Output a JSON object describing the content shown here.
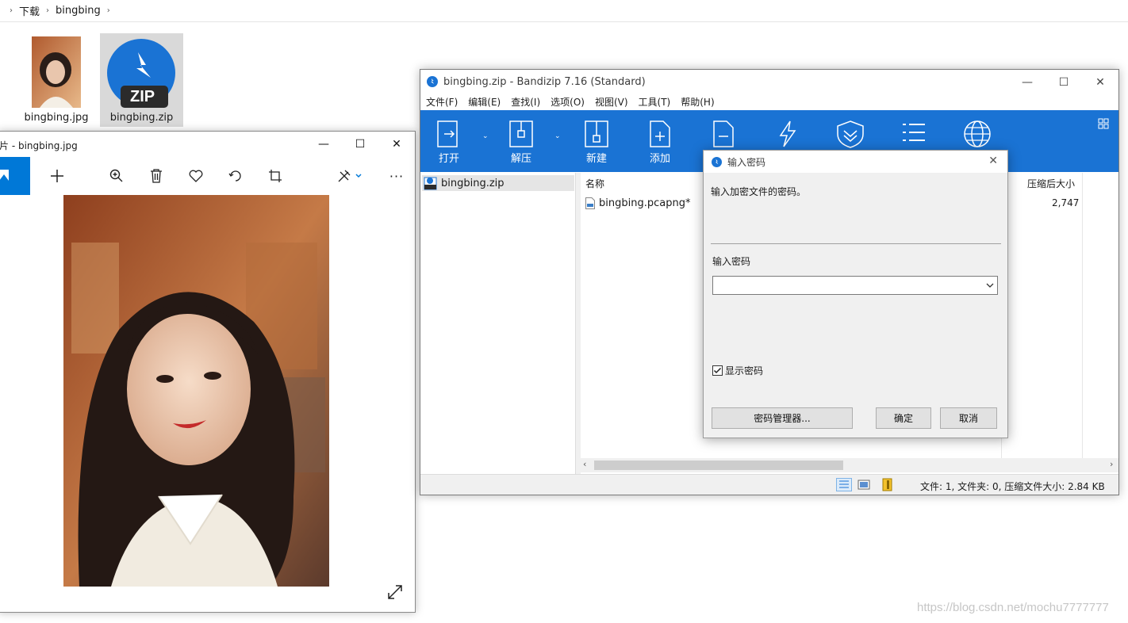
{
  "explorer": {
    "breadcrumb": [
      "下载",
      "bingbing"
    ],
    "files": [
      {
        "name": "bingbing.jpg",
        "icon": "photo-thumbnail"
      },
      {
        "name": "bingbing.zip",
        "icon": "bandizip-zip-icon",
        "badge": "ZIP"
      }
    ]
  },
  "photos": {
    "title": "片 - bingbing.jpg",
    "toolbar": [
      "photo-mode-icon",
      "add-icon",
      "zoom-icon",
      "delete-icon",
      "favorite-icon",
      "rotate-icon",
      "crop-icon",
      "edit-icon",
      "more-icon"
    ]
  },
  "bandizip": {
    "title": "bingbing.zip - Bandizip 7.16 (Standard)",
    "menu": [
      "文件(F)",
      "编辑(E)",
      "查找(I)",
      "选项(O)",
      "视图(V)",
      "工具(T)",
      "帮助(H)"
    ],
    "toolbar": [
      {
        "label": "打开",
        "icon": "open-icon"
      },
      {
        "label": "解压",
        "icon": "extract-icon"
      },
      {
        "label": "新建",
        "icon": "new-archive-icon"
      },
      {
        "label": "添加",
        "icon": "add-file-icon"
      },
      {
        "label": "",
        "icon": "delete-file-icon"
      },
      {
        "label": "",
        "icon": "test-icon"
      },
      {
        "label": "",
        "icon": "shield-icon"
      },
      {
        "label": "",
        "icon": "list-icon"
      },
      {
        "label": "",
        "icon": "globe-icon"
      }
    ],
    "tree": {
      "item": "bingbing.zip"
    },
    "columns": {
      "name": "名称",
      "packed": "压缩后大小"
    },
    "rows": [
      {
        "name": "bingbing.pcapng*",
        "packed": "2,747"
      }
    ],
    "status": "文件: 1, 文件夹: 0, 压缩文件大小: 2.84 KB"
  },
  "dialog": {
    "title": "输入密码",
    "message": "输入加密文件的密码。",
    "password_label": "输入密码",
    "password_value": "",
    "show_password_label": "显示密码",
    "show_password_checked": true,
    "manager_button": "密码管理器...",
    "ok_button": "确定",
    "cancel_button": "取消"
  },
  "watermark": "https://blog.csdn.net/mochu7777777",
  "colors": {
    "bandizip_blue": "#1a73d4",
    "accent": "#0078d7"
  }
}
